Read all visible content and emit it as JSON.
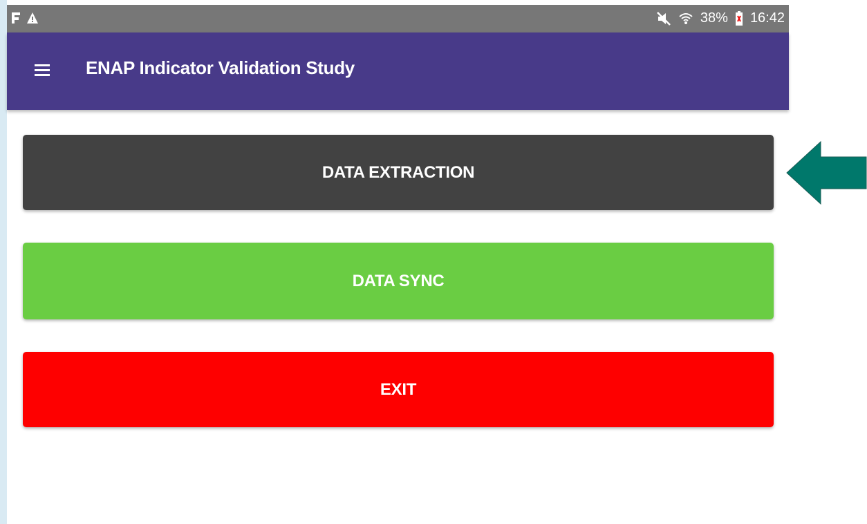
{
  "status_bar": {
    "left_icons": [
      "f-notification-icon",
      "warning-icon"
    ],
    "right_icons": [
      "mute-icon",
      "wifi-icon",
      "battery-icon"
    ],
    "battery": "38%",
    "time": "16:42"
  },
  "app_bar": {
    "title": "ENAP Indicator Validation Study",
    "menu_icon": "hamburger-menu-icon"
  },
  "buttons": {
    "data_extraction": "DATA EXTRACTION",
    "data_sync": "DATA SYNC",
    "exit": "EXIT"
  },
  "colors": {
    "app_bar": "#483a89",
    "status_bar": "#777777",
    "data_extraction": "#424242",
    "data_sync": "#6acd43",
    "exit": "#fe0000",
    "arrow": "#00786b"
  },
  "annotation": {
    "arrow_icon": "left-pointing-arrow-icon"
  }
}
